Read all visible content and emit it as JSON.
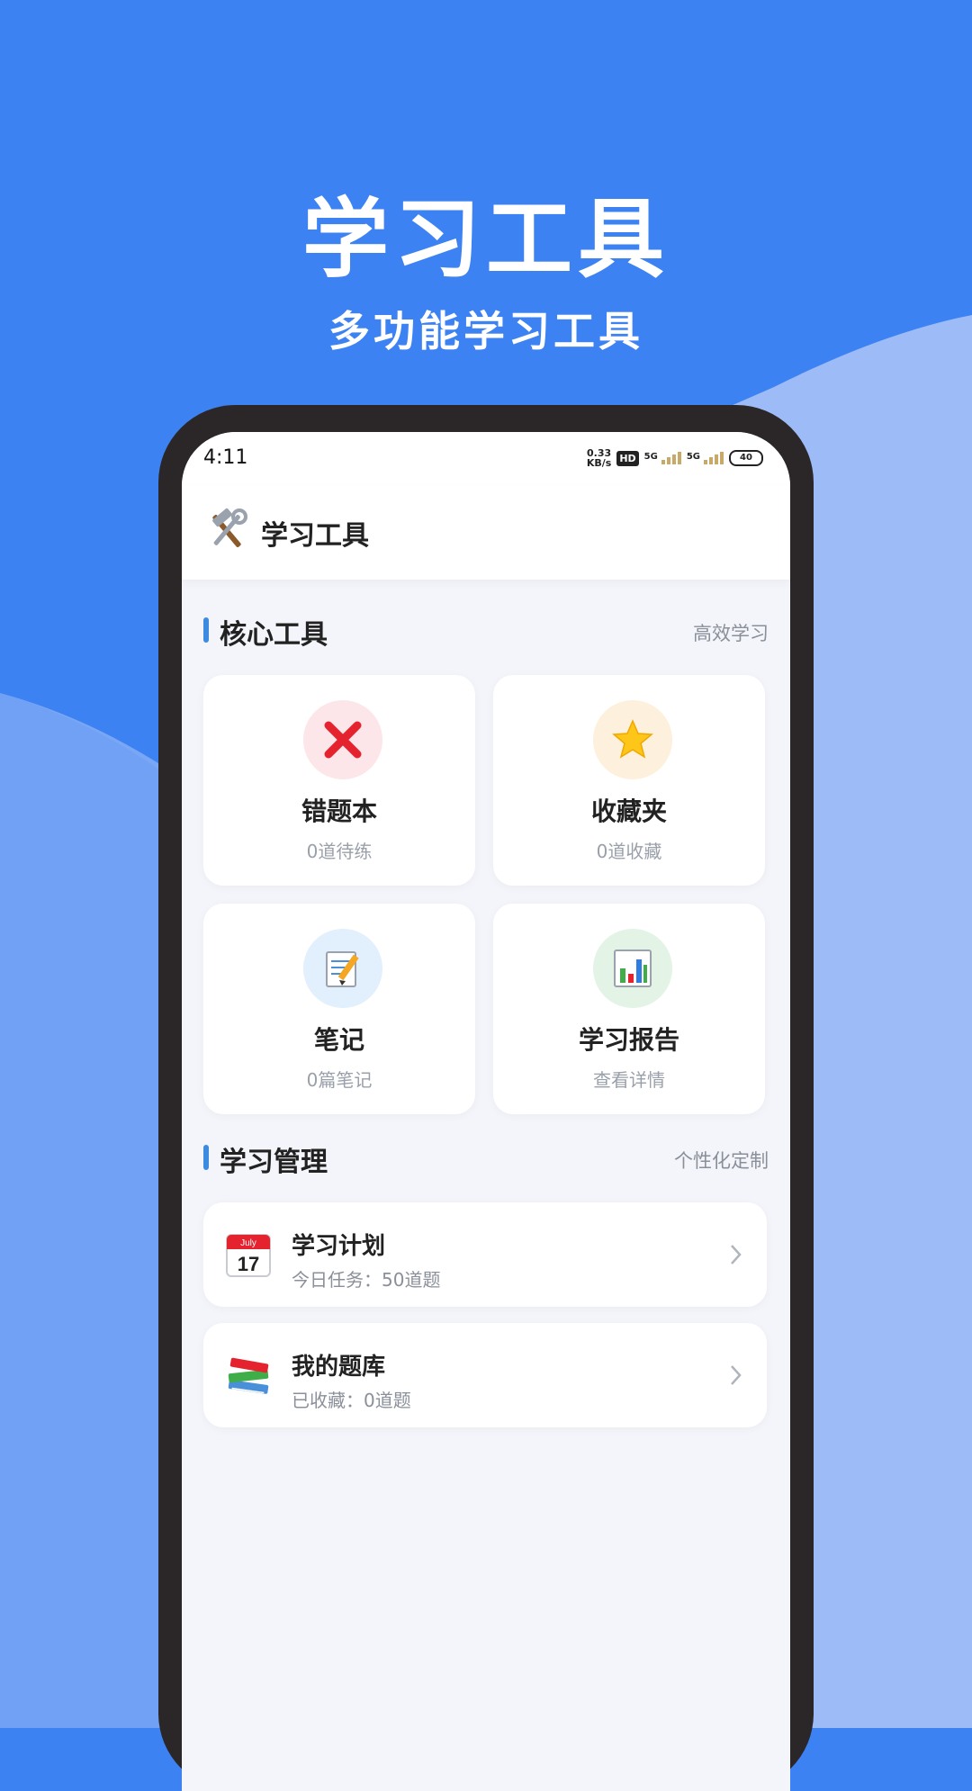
{
  "colors": {
    "background": "#3d82f2",
    "accent": "#3d8be0"
  },
  "hero": {
    "title": "学习工具",
    "subtitle": "多功能学习工具"
  },
  "statusbar": {
    "time": "4:11",
    "net_speed_value": "0.33",
    "net_speed_unit": "KB/s",
    "hd": "HD",
    "signal1_label": "5G",
    "signal2_label": "5G",
    "battery": "40"
  },
  "appbar": {
    "icon": "hammer-wrench-icon",
    "title": "学习工具"
  },
  "core_tools": {
    "title": "核心工具",
    "link": "高效学习",
    "cards": [
      {
        "icon": "cross-mark-icon",
        "title": "错题本",
        "subtitle": "0道待练"
      },
      {
        "icon": "star-icon",
        "title": "收藏夹",
        "subtitle": "0道收藏"
      },
      {
        "icon": "memo-pencil-icon",
        "title": "笔记",
        "subtitle": "0篇笔记"
      },
      {
        "icon": "bar-chart-icon",
        "title": "学习报告",
        "subtitle": "查看详情"
      }
    ]
  },
  "management": {
    "title": "学习管理",
    "link": "个性化定制",
    "items": [
      {
        "icon": "calendar-icon",
        "calendar_month": "July",
        "calendar_day": "17",
        "title": "学习计划",
        "subtitle": "今日任务：50道题"
      },
      {
        "icon": "books-icon",
        "title": "我的题库",
        "subtitle": "已收藏：0道题"
      }
    ]
  }
}
